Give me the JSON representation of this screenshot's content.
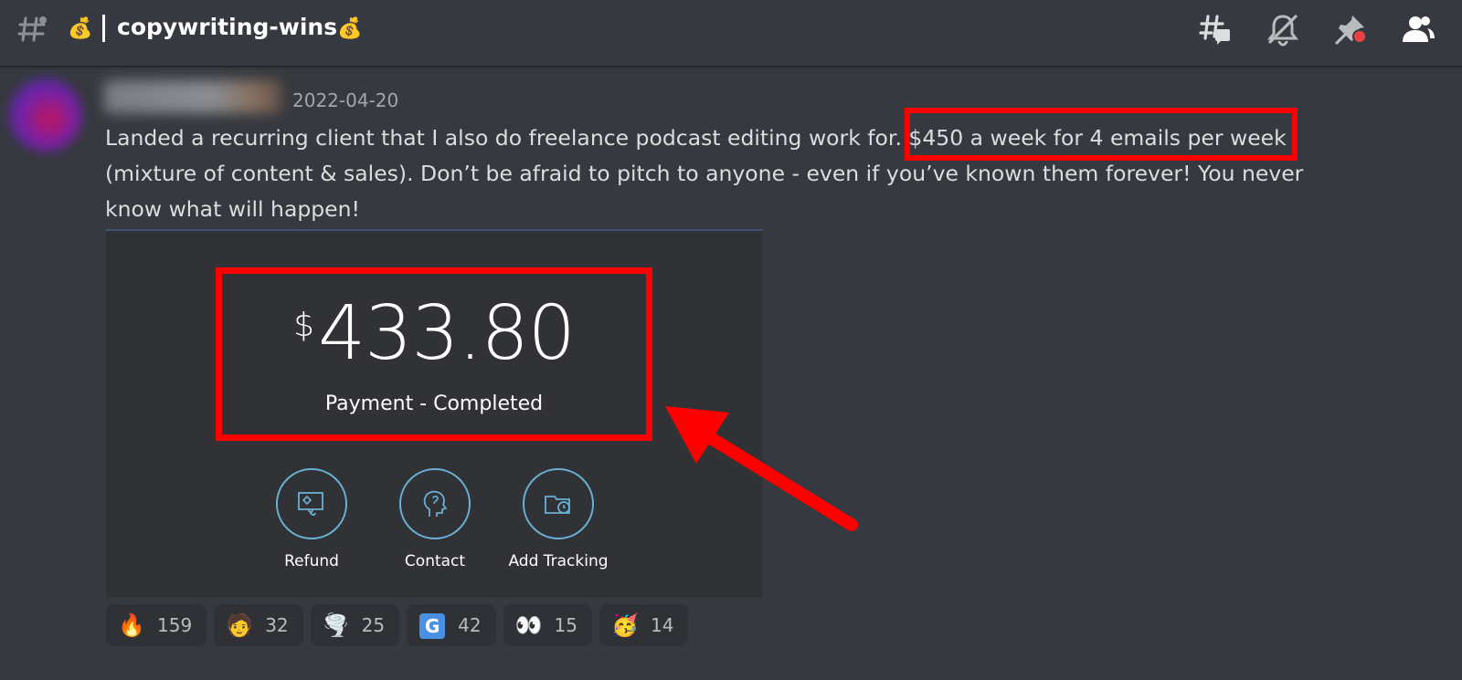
{
  "header": {
    "channel_emoji_left": "💰",
    "channel_name": "copywriting-wins",
    "channel_emoji_right": "💰",
    "icons": [
      "threads-icon",
      "mute-notifications-icon",
      "pinned-messages-icon",
      "member-list-icon"
    ]
  },
  "message": {
    "timestamp": "2022-04-20",
    "text_line1": "Landed a recurring client that I also do freelance podcast editing work for. $450 a week for 4 emails per week",
    "text_line2": "(mixture of content & sales). Don’t be afraid to pitch to anyone - even if you’ve known them forever! You never",
    "text_line3": "know what will happen!"
  },
  "embed": {
    "currency_symbol": "$",
    "amount": "433.80",
    "status": "Payment - Completed",
    "actions": [
      {
        "label": "Refund",
        "icon": "refund-icon"
      },
      {
        "label": "Contact",
        "icon": "contact-icon"
      },
      {
        "label": "Add Tracking",
        "icon": "add-tracking-icon"
      }
    ]
  },
  "reactions": [
    {
      "emoji": "🔥",
      "count": "159"
    },
    {
      "emoji": "🧑",
      "count": "32"
    },
    {
      "emoji": "🌪️",
      "count": "25"
    },
    {
      "emoji": "G",
      "count": "42"
    },
    {
      "emoji": "👀",
      "count": "15"
    },
    {
      "emoji": "🥳",
      "count": "14"
    }
  ],
  "colors": {
    "background": "#36393f",
    "highlight_box": "#ff0000",
    "accent_circle": "#6ab0d6"
  }
}
